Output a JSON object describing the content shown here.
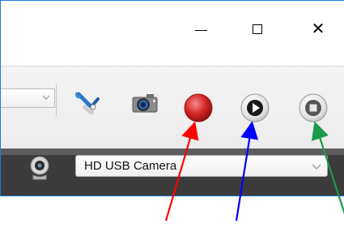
{
  "window": {
    "minimize_icon": "minimize-icon",
    "maximize_icon": "maximize-icon",
    "close_glyph": "✕"
  },
  "toolbar": {
    "dropdown_value": "",
    "icons": [
      "settings-wrench-icon",
      "snapshot-camera-icon",
      "record-icon",
      "play-icon",
      "stop-icon"
    ]
  },
  "camera": {
    "selected": "HD USB Camera",
    "icon": "webcam-icon"
  },
  "annotations": {
    "arrow_colors": [
      "#ff0000",
      "#0000ff",
      "#1a9a4a"
    ]
  }
}
